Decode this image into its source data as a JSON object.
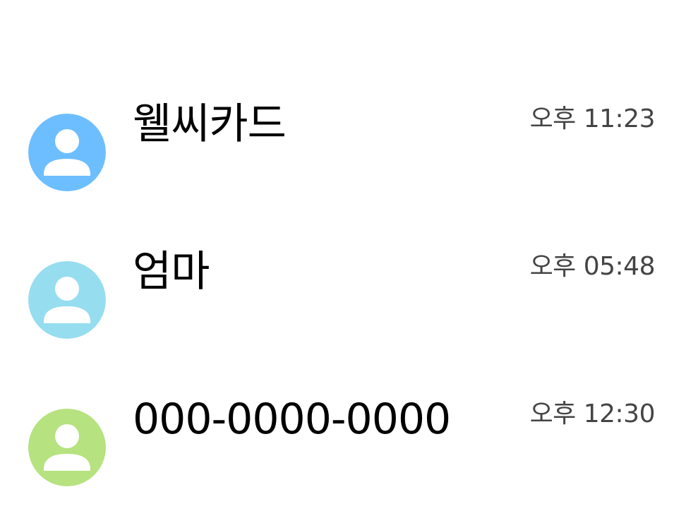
{
  "conversations": [
    {
      "name": "웰씨카드",
      "time": "오후 11:23",
      "avatar_color": "#6DBEFF",
      "avatar_icon": "person-icon"
    },
    {
      "name": "엄마",
      "time": "오후 05:48",
      "avatar_color": "#97DDF0",
      "avatar_icon": "person-icon"
    },
    {
      "name": "000-0000-0000",
      "time": "오후 12:30",
      "avatar_color": "#B6E27F",
      "avatar_icon": "person-icon"
    }
  ]
}
